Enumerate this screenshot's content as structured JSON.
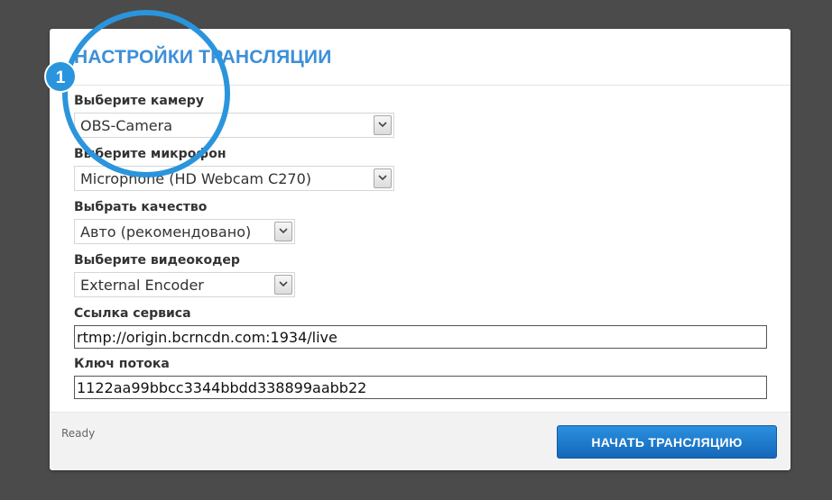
{
  "panel": {
    "title": "НАСТРОЙКИ ТРАНСЛЯЦИИ"
  },
  "fields": {
    "camera": {
      "label": "Выберите камеру",
      "value": "OBS-Camera"
    },
    "microphone": {
      "label": "Выберите микрофон",
      "value": "Microphone (HD Webcam C270)"
    },
    "quality": {
      "label": "Выбрать качество",
      "value": "Авто (рекомендовано)"
    },
    "encoder": {
      "label": "Выберите видеокодер",
      "value": "External Encoder"
    },
    "service_url": {
      "label": "Ссылка сервиса",
      "value": "rtmp://origin.bcrncdn.com:1934/live"
    },
    "stream_key": {
      "label": "Ключ потока",
      "value": "1122aa99bbcc3344bbdd338899aabb22"
    }
  },
  "footer": {
    "status": "Ready",
    "start_button": "НАЧАТЬ ТРАНСЛЯЦИЮ"
  },
  "annotation": {
    "badge_number": "1",
    "color": "#2a95dc"
  }
}
